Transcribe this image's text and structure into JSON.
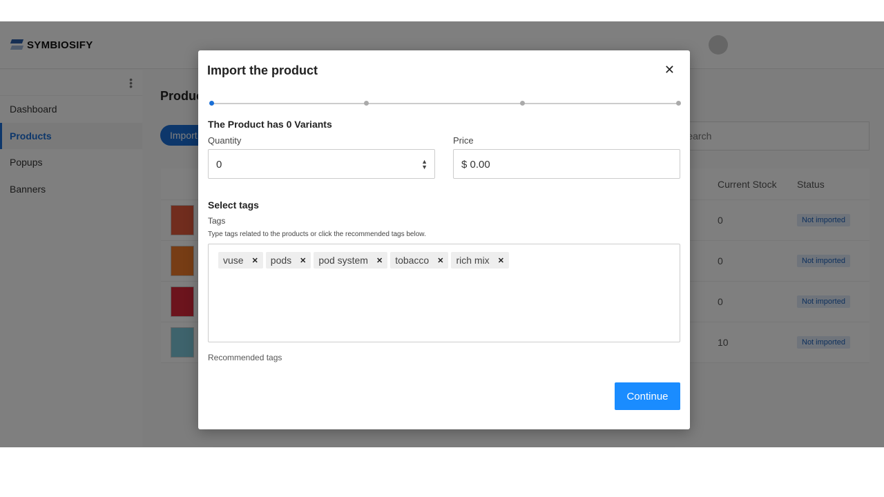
{
  "app": {
    "brand": "SYMBIOSIFY",
    "page_title": "Products",
    "import_label": "Import",
    "search_placeholder": "Search"
  },
  "sidebar": {
    "items": [
      {
        "label": "Dashboard"
      },
      {
        "label": "Products",
        "active": true
      },
      {
        "label": "Popups"
      },
      {
        "label": "Banners"
      }
    ]
  },
  "table": {
    "headers": {
      "stock": "Current Stock",
      "status": "Status"
    },
    "rows": [
      {
        "stock": "0",
        "status": "Not imported"
      },
      {
        "stock": "0",
        "status": "Not imported"
      },
      {
        "stock": "0",
        "status": "Not imported"
      },
      {
        "stock": "10",
        "status": "Not imported"
      }
    ]
  },
  "modal": {
    "title": "Import the product",
    "close_icon": "close-icon",
    "steps_total": 4,
    "current_step": 1,
    "variants_heading": "The Product has 0 Variants",
    "quantity_label": "Quantity",
    "quantity_value": "0",
    "price_label": "Price",
    "price_value": "$ 0.00",
    "tags_heading": "Select tags",
    "tags_label": "Tags",
    "tags_hint": "Type tags related to the products or click the recommended tags below.",
    "tags": [
      "vuse",
      "pods",
      "pod system",
      "tobacco",
      "rich mix"
    ],
    "recommended_label": "Recommended tags",
    "continue_label": "Continue"
  },
  "colors": {
    "accent": "#1a8cff",
    "brand": "#1a6fd6"
  }
}
